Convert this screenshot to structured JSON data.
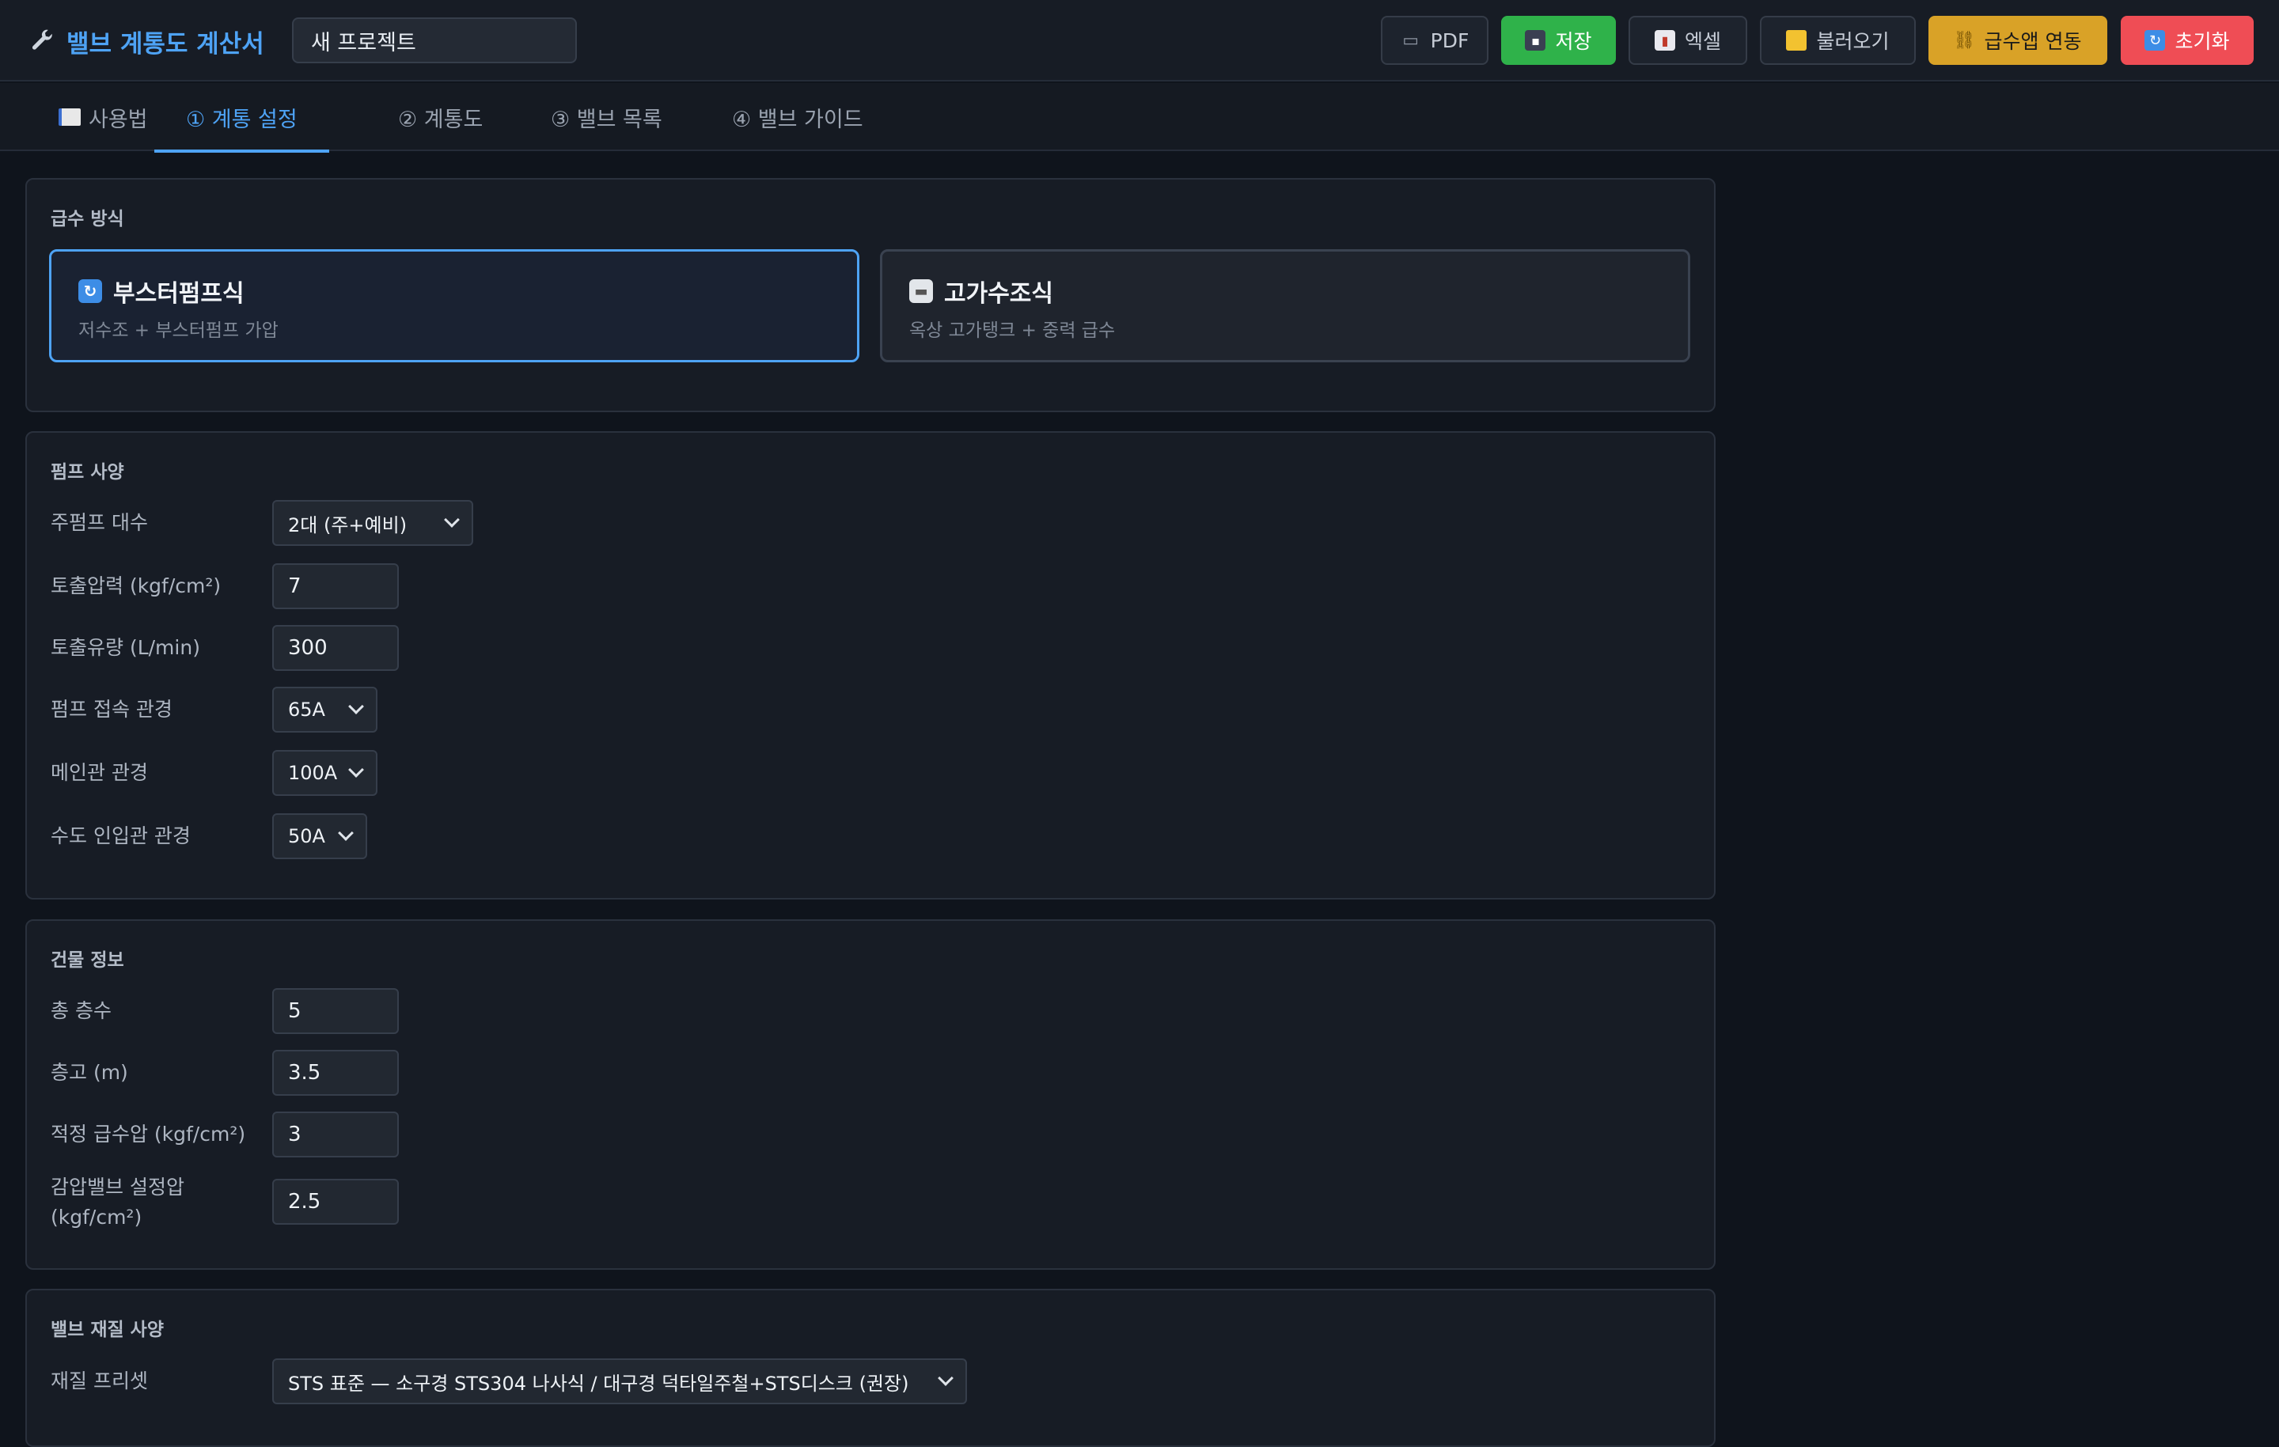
{
  "app": {
    "title": "밸브 계통도 계산서",
    "project_name": "새 프로젝트"
  },
  "toolbar": {
    "pdf": "PDF",
    "save": "저장",
    "excel": "엑셀",
    "load": "불러오기",
    "link": "급수앱 연동",
    "reset": "초기화"
  },
  "tabs": [
    {
      "label": "사용법",
      "icon": "book-icon"
    },
    {
      "label": "① 계통 설정",
      "active": true
    },
    {
      "label": "② 계통도"
    },
    {
      "label": "③ 밸브 목록"
    },
    {
      "label": "④ 밸브 가이드"
    }
  ],
  "supply": {
    "title": "급수 방식",
    "modes": [
      {
        "title": "부스터펌프식",
        "desc": "저수조 + 부스터펌프 가압",
        "selected": true,
        "icon": "refresh-icon"
      },
      {
        "title": "고가수조식",
        "desc": "옥상 고가탱크 + 중력 급수",
        "selected": false,
        "icon": "tank-icon"
      }
    ]
  },
  "pump": {
    "title": "펌프 사양",
    "count_label": "주펌프 대수",
    "count_value": "2대 (주+예비)",
    "pressure_label": "토출압력 (kgf/cm²)",
    "pressure_value": "7",
    "flow_label": "토출유량 (L/min)",
    "flow_value": "300",
    "connect_label": "펌프 접속 관경",
    "connect_value": "65A",
    "main_label": "메인관 관경",
    "main_value": "100A",
    "inlet_label": "수도 인입관 관경",
    "inlet_value": "50A"
  },
  "building": {
    "title": "건물 정보",
    "floors_label": "총 층수",
    "floors_value": "5",
    "height_label": "층고 (m)",
    "height_value": "3.5",
    "pressure_label": "적정 급수압 (kgf/cm²)",
    "pressure_value": "3",
    "prv_label_1": "감압밸브 설정압",
    "prv_label_2": "(kgf/cm²)",
    "prv_value": "2.5"
  },
  "material": {
    "title": "밸브 재질 사양",
    "preset_label": "재질 프리셋",
    "preset_value": "STS 표준 — 소구경 STS304 나사식 / 대구경 덕타일주철+STS디스크 (권장)"
  },
  "colors": {
    "accent": "#4ea3f5",
    "save": "#2fb24a",
    "link": "#d9a227",
    "reset": "#ef4d55",
    "background": "#0f141c"
  }
}
